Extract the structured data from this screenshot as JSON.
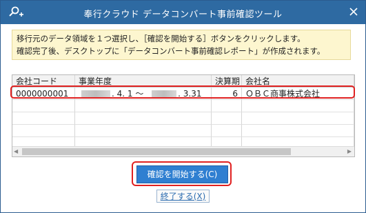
{
  "window": {
    "title": "奉行クラウド データコンバート事前確認ツール"
  },
  "info": {
    "line1": "移行元のデータ領域を１つ選択し、［確認を開始する］ボタンをクリックします。",
    "line2": "確認完了後、デスクトップに「データコンバート事前確認レポート」が作成されます。"
  },
  "table": {
    "headers": [
      "会社コード",
      "事業年度",
      "決算期",
      "会社名"
    ],
    "rows": [
      {
        "company_code": "0000000001",
        "fiscal_start": ". 4. 1 ～",
        "fiscal_end": ". 3.31",
        "period": "6",
        "company_name": "ＯＢＣ商事株式会社"
      }
    ]
  },
  "buttons": {
    "confirm": "確認を開始する(C)",
    "exit": "終了する(X)"
  },
  "colors": {
    "titlebar": "#2e6aa2",
    "info_bg": "#fdf6cf",
    "highlight": "#e02020",
    "primary_button": "#2f7fd1"
  }
}
